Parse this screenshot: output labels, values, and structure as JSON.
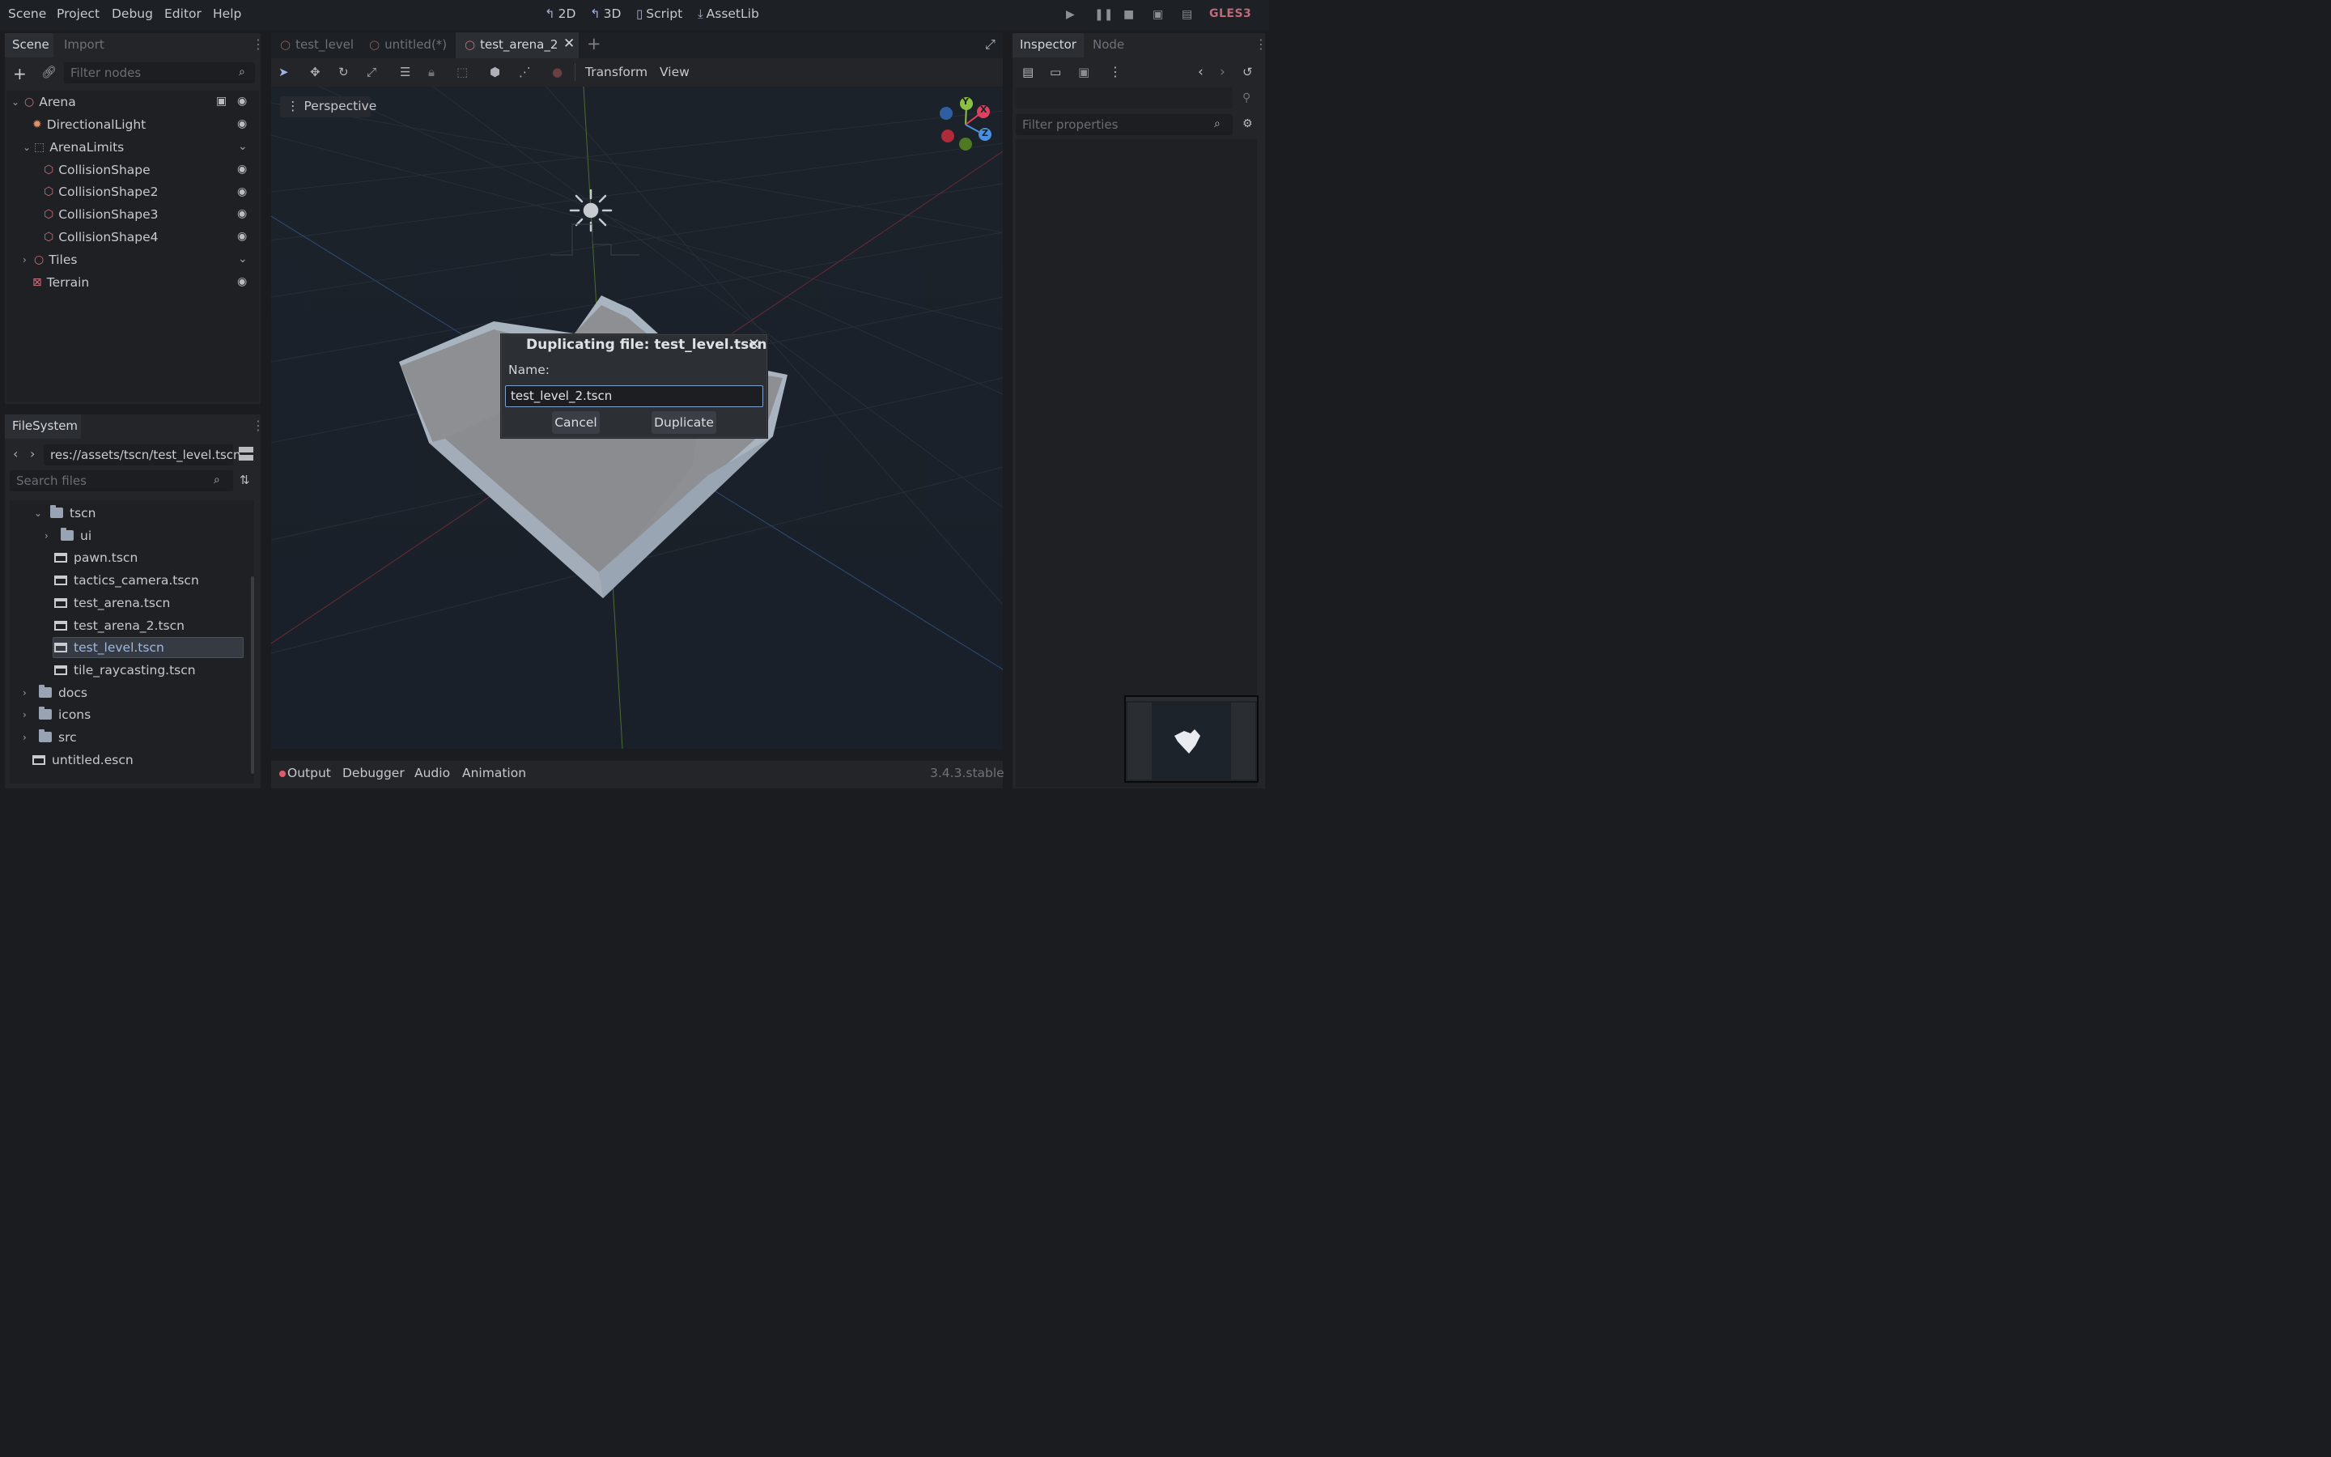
{
  "menubar": {
    "items": [
      "Scene",
      "Project",
      "Debug",
      "Editor",
      "Help"
    ],
    "main_screens": [
      "2D",
      "3D",
      "Script",
      "AssetLib"
    ],
    "renderer": "GLES3"
  },
  "scene_dock": {
    "tabs": [
      "Scene",
      "Import"
    ],
    "filter_placeholder": "Filter nodes",
    "nodes": [
      {
        "label": "Arena",
        "icon": "node-3d-icon"
      },
      {
        "label": "DirectionalLight",
        "icon": "light-icon"
      },
      {
        "label": "ArenaLimits",
        "icon": "area-icon"
      },
      {
        "label": "CollisionShape",
        "icon": "collision-shape-icon"
      },
      {
        "label": "CollisionShape2",
        "icon": "collision-shape-icon"
      },
      {
        "label": "CollisionShape3",
        "icon": "collision-shape-icon"
      },
      {
        "label": "CollisionShape4",
        "icon": "collision-shape-icon"
      },
      {
        "label": "Tiles",
        "icon": "node-3d-icon"
      },
      {
        "label": "Terrain",
        "icon": "mesh-instance-icon"
      }
    ]
  },
  "filesystem_dock": {
    "tab": "FileSystem",
    "path": "res://assets/tscn/test_level.tscn",
    "search_placeholder": "Search files",
    "items": [
      {
        "label": "tscn",
        "type": "folder"
      },
      {
        "label": "ui",
        "type": "folder"
      },
      {
        "label": "pawn.tscn",
        "type": "scene"
      },
      {
        "label": "tactics_camera.tscn",
        "type": "scene"
      },
      {
        "label": "test_arena.tscn",
        "type": "scene"
      },
      {
        "label": "test_arena_2.tscn",
        "type": "scene"
      },
      {
        "label": "test_level.tscn",
        "type": "scene",
        "selected": true
      },
      {
        "label": "tile_raycasting.tscn",
        "type": "scene"
      },
      {
        "label": "docs",
        "type": "folder"
      },
      {
        "label": "icons",
        "type": "folder"
      },
      {
        "label": "src",
        "type": "folder"
      },
      {
        "label": "untitled.escn",
        "type": "scene"
      }
    ]
  },
  "editor_tabs": [
    "test_level",
    "untitled(*)",
    "test_arena_2"
  ],
  "viewport_toolbar": {
    "transform_menu": "Transform",
    "view_menu": "View",
    "perspective_label": "Perspective"
  },
  "dialog": {
    "title": "Duplicating file: test_level.tscn",
    "name_label": "Name:",
    "name_value": "test_level_2.tscn",
    "cancel_label": "Cancel",
    "duplicate_label": "Duplicate"
  },
  "inspector": {
    "tabs": [
      "Inspector",
      "Node"
    ],
    "filter_placeholder": "Filter properties"
  },
  "bottom_panel": {
    "tabs": [
      "Output",
      "Debugger",
      "Audio",
      "Animation"
    ],
    "version": "3.4.3.stable"
  },
  "gizmo_axes": [
    "X",
    "Y",
    "Z"
  ],
  "colors": {
    "background": "#1a1c20",
    "panel": "#232529",
    "accent": "#7ea0c9",
    "renderer": "#c06a78"
  }
}
